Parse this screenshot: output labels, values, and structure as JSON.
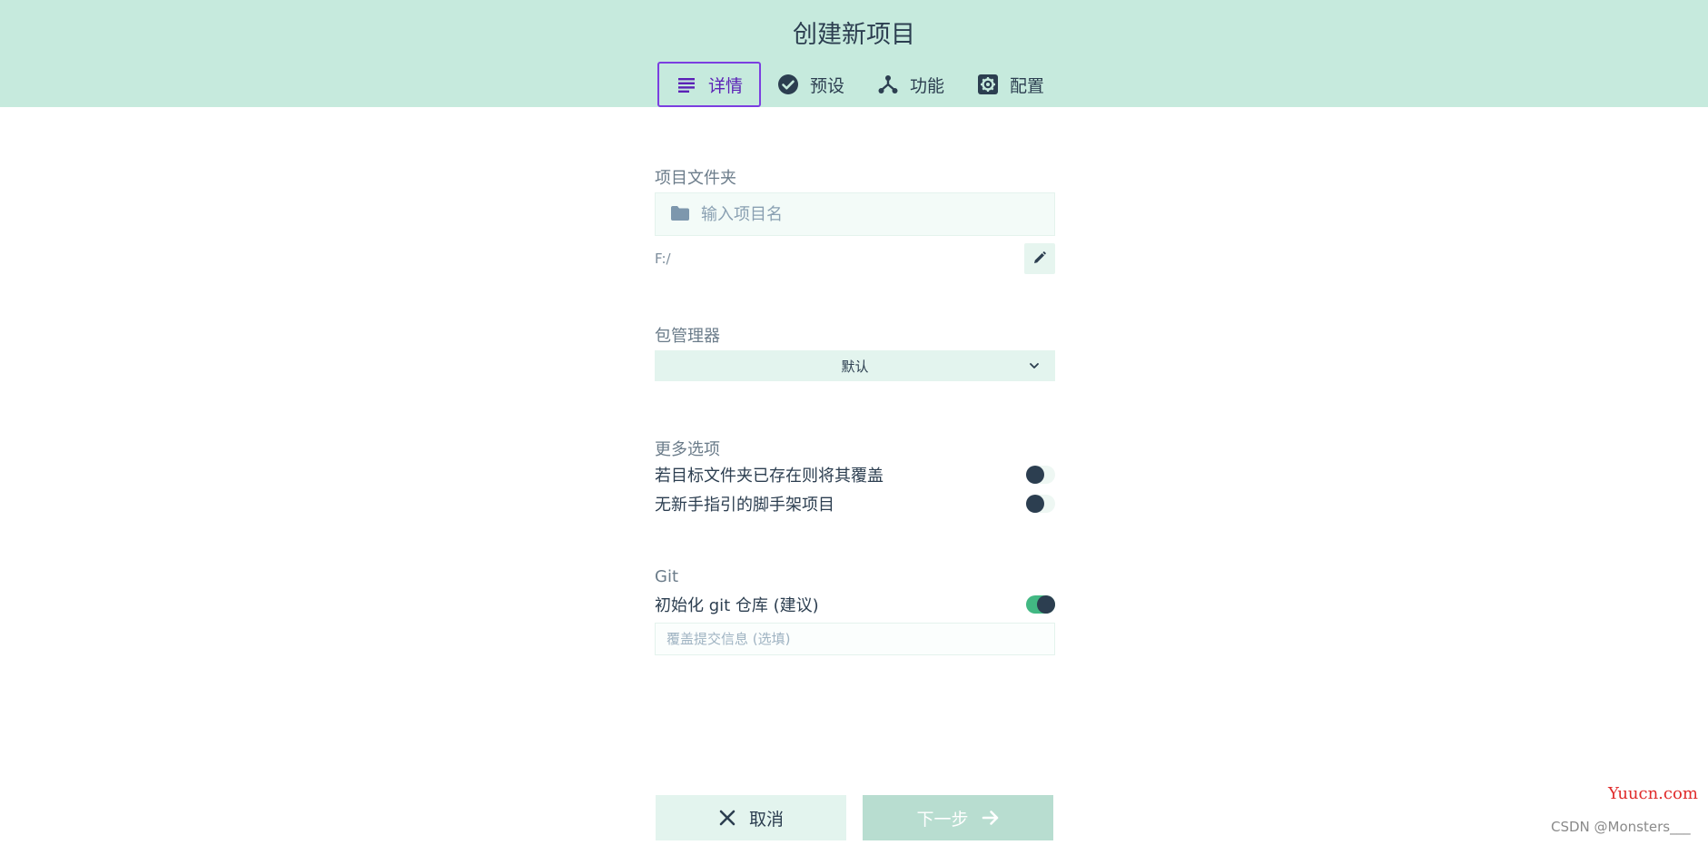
{
  "header": {
    "title": "创建新项目",
    "tabs": [
      {
        "label": "详情",
        "icon": "list-icon",
        "active": true
      },
      {
        "label": "预设",
        "icon": "check-circle-icon",
        "active": false
      },
      {
        "label": "功能",
        "icon": "fork-icon",
        "active": false
      },
      {
        "label": "配置",
        "icon": "settings-icon",
        "active": false
      }
    ]
  },
  "folder": {
    "label": "项目文件夹",
    "placeholder": "输入项目名",
    "value": "",
    "path": "F:/"
  },
  "package_manager": {
    "label": "包管理器",
    "selected": "默认"
  },
  "more_options": {
    "label": "更多选项",
    "items": [
      {
        "label": "若目标文件夹已存在则将其覆盖",
        "enabled": false
      },
      {
        "label": "无新手指引的脚手架项目",
        "enabled": false
      }
    ]
  },
  "git": {
    "label": "Git",
    "init_label": "初始化 git 仓库 (建议)",
    "init_enabled": true,
    "commit_placeholder": "覆盖提交信息 (选填)"
  },
  "footer": {
    "cancel_label": "取消",
    "next_label": "下一步"
  },
  "watermark": {
    "site": "Yuucn.com",
    "author": "CSDN @Monsters___"
  },
  "colors": {
    "header_bg": "#c6eadd",
    "accent": "#42b883",
    "active_tab_border": "#7b3fe0",
    "text": "#2c3e50"
  }
}
